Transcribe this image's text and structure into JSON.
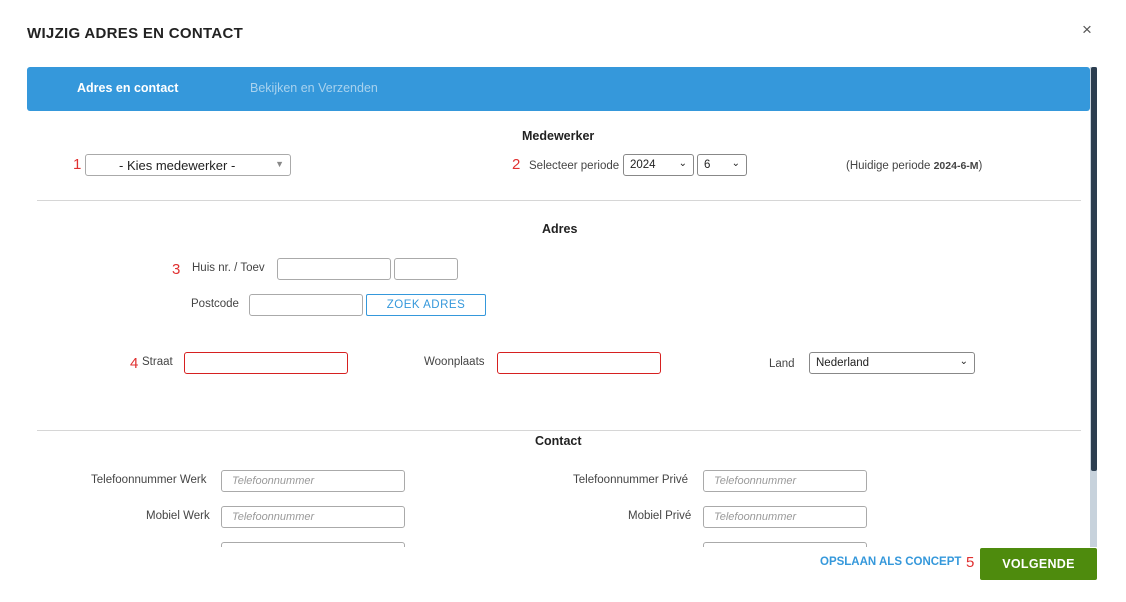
{
  "dialog": {
    "title": "WIJZIG ADRES EN CONTACT",
    "close_icon": "×"
  },
  "tabs": [
    {
      "label": "Adres en contact",
      "active": true
    },
    {
      "label": "Bekijken en Verzenden",
      "active": false
    }
  ],
  "markers": [
    "1",
    "2",
    "3",
    "4",
    "5"
  ],
  "medewerker": {
    "heading": "Medewerker",
    "select_value": "- Kies medewerker -",
    "periode_label": "Selecteer periode",
    "year_value": "2024",
    "month_value": "6",
    "huidige_prefix": "(Huidige periode ",
    "huidige_value": "2024-6-M",
    "huidige_suffix": ")"
  },
  "adres": {
    "heading": "Adres",
    "huisnr_label": "Huis nr. / Toev",
    "postcode_label": "Postcode",
    "zoek_button": "ZOEK ADRES",
    "straat_label": "Straat",
    "woonplaats_label": "Woonplaats",
    "land_label": "Land",
    "land_value": "Nederland"
  },
  "contact": {
    "heading": "Contact",
    "tel_werk_label": "Telefoonnummer Werk",
    "tel_prive_label": "Telefoonnummer Privé",
    "mobiel_werk_label": "Mobiel Werk",
    "mobiel_prive_label": "Mobiel Privé",
    "placeholder": "Telefoonnummer"
  },
  "footer": {
    "concept_link": "OPSLAAN ALS CONCEPT",
    "next_button": "VOLGENDE"
  },
  "colors": {
    "tab_bar": "#3598db",
    "next_button": "#4e8b0d",
    "marker": "#e03030",
    "error_border": "#d62020"
  }
}
